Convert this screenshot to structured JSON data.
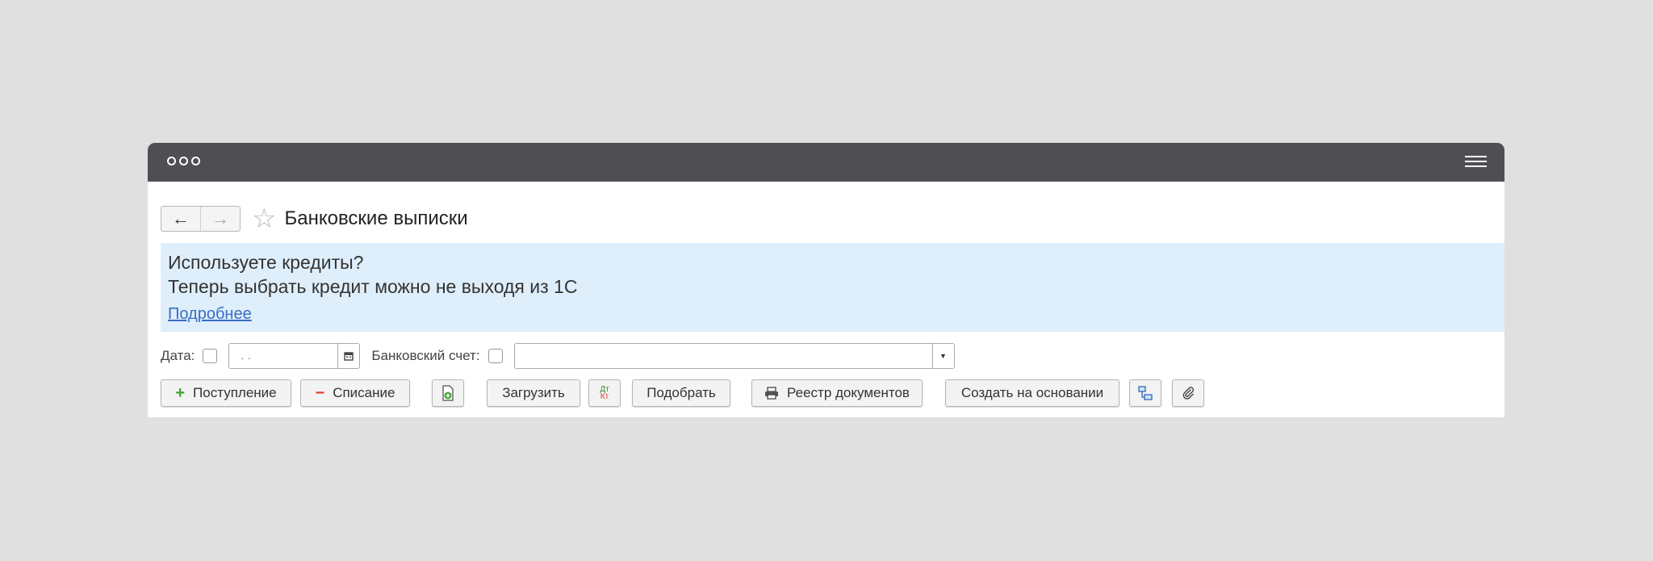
{
  "window": {
    "icons": {
      "dots": "three-circle-window-controls",
      "menu": "hamburger-menu-icon"
    }
  },
  "header": {
    "back": "←",
    "forward": "→",
    "favorite": "☆",
    "title": "Банковские выписки"
  },
  "banner": {
    "line1": "Используете кредиты?",
    "line2": "Теперь выбрать кредит можно не выходя из 1С",
    "link": "Подробнее",
    "background": "#deeefb"
  },
  "filters": {
    "date_label": "Дата:",
    "date_value": " .  .",
    "account_label": "Банковский счет:",
    "account_value": ""
  },
  "toolbar": {
    "income": "Поступление",
    "expense": "Списание",
    "load": "Загрузить",
    "dt": "Дт",
    "kt": "Кт",
    "select": "Подобрать",
    "registry": "Реестр документов",
    "create_based": "Создать на основании"
  },
  "colors": {
    "titlebar": "#4f4e53",
    "link": "#3b6ec4",
    "plus": "#3ba52c",
    "minus": "#e03a2f"
  }
}
